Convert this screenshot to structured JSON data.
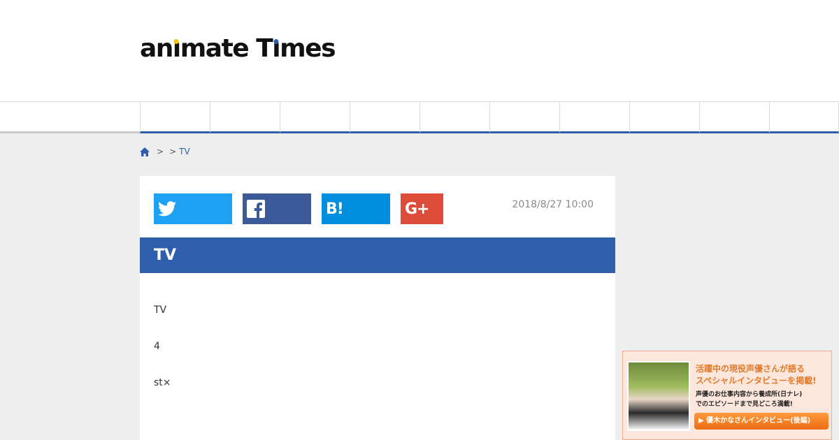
{
  "logo": {
    "part1": "an",
    "i1": "ı",
    "part2": "mate T",
    "i2": "ı",
    "part3": "mes"
  },
  "colors": {
    "brand_blue": "#2f5fab",
    "twitter": "#1da1f2",
    "facebook": "#3b5998",
    "hatena": "#008fde",
    "google_plus": "#dd4b39",
    "logo_dot_yellow": "#f3c200"
  },
  "breadcrumb": {
    "sep1": ">",
    "sep2": ">",
    "current": "TV"
  },
  "share": {
    "twitter_icon": "twitter-bird-icon",
    "facebook_icon": "facebook-f-icon",
    "hatena_label": "B!",
    "gplus_label": "G+"
  },
  "article": {
    "date": "2018/8/27 10:00",
    "title": "TV",
    "paragraphs": [
      "TV",
      "4",
      "st×"
    ]
  },
  "banner": {
    "line1": "活躍中の現役声優さんが語る",
    "line2": "スペシャルインタビューを掲載!",
    "line3": "声優のお仕事内容から養成所(日ナレ)",
    "line4": "でのエピソードまで見どころ満載!",
    "cta": "▶ 優木かなさんインタビュー(後編)"
  }
}
